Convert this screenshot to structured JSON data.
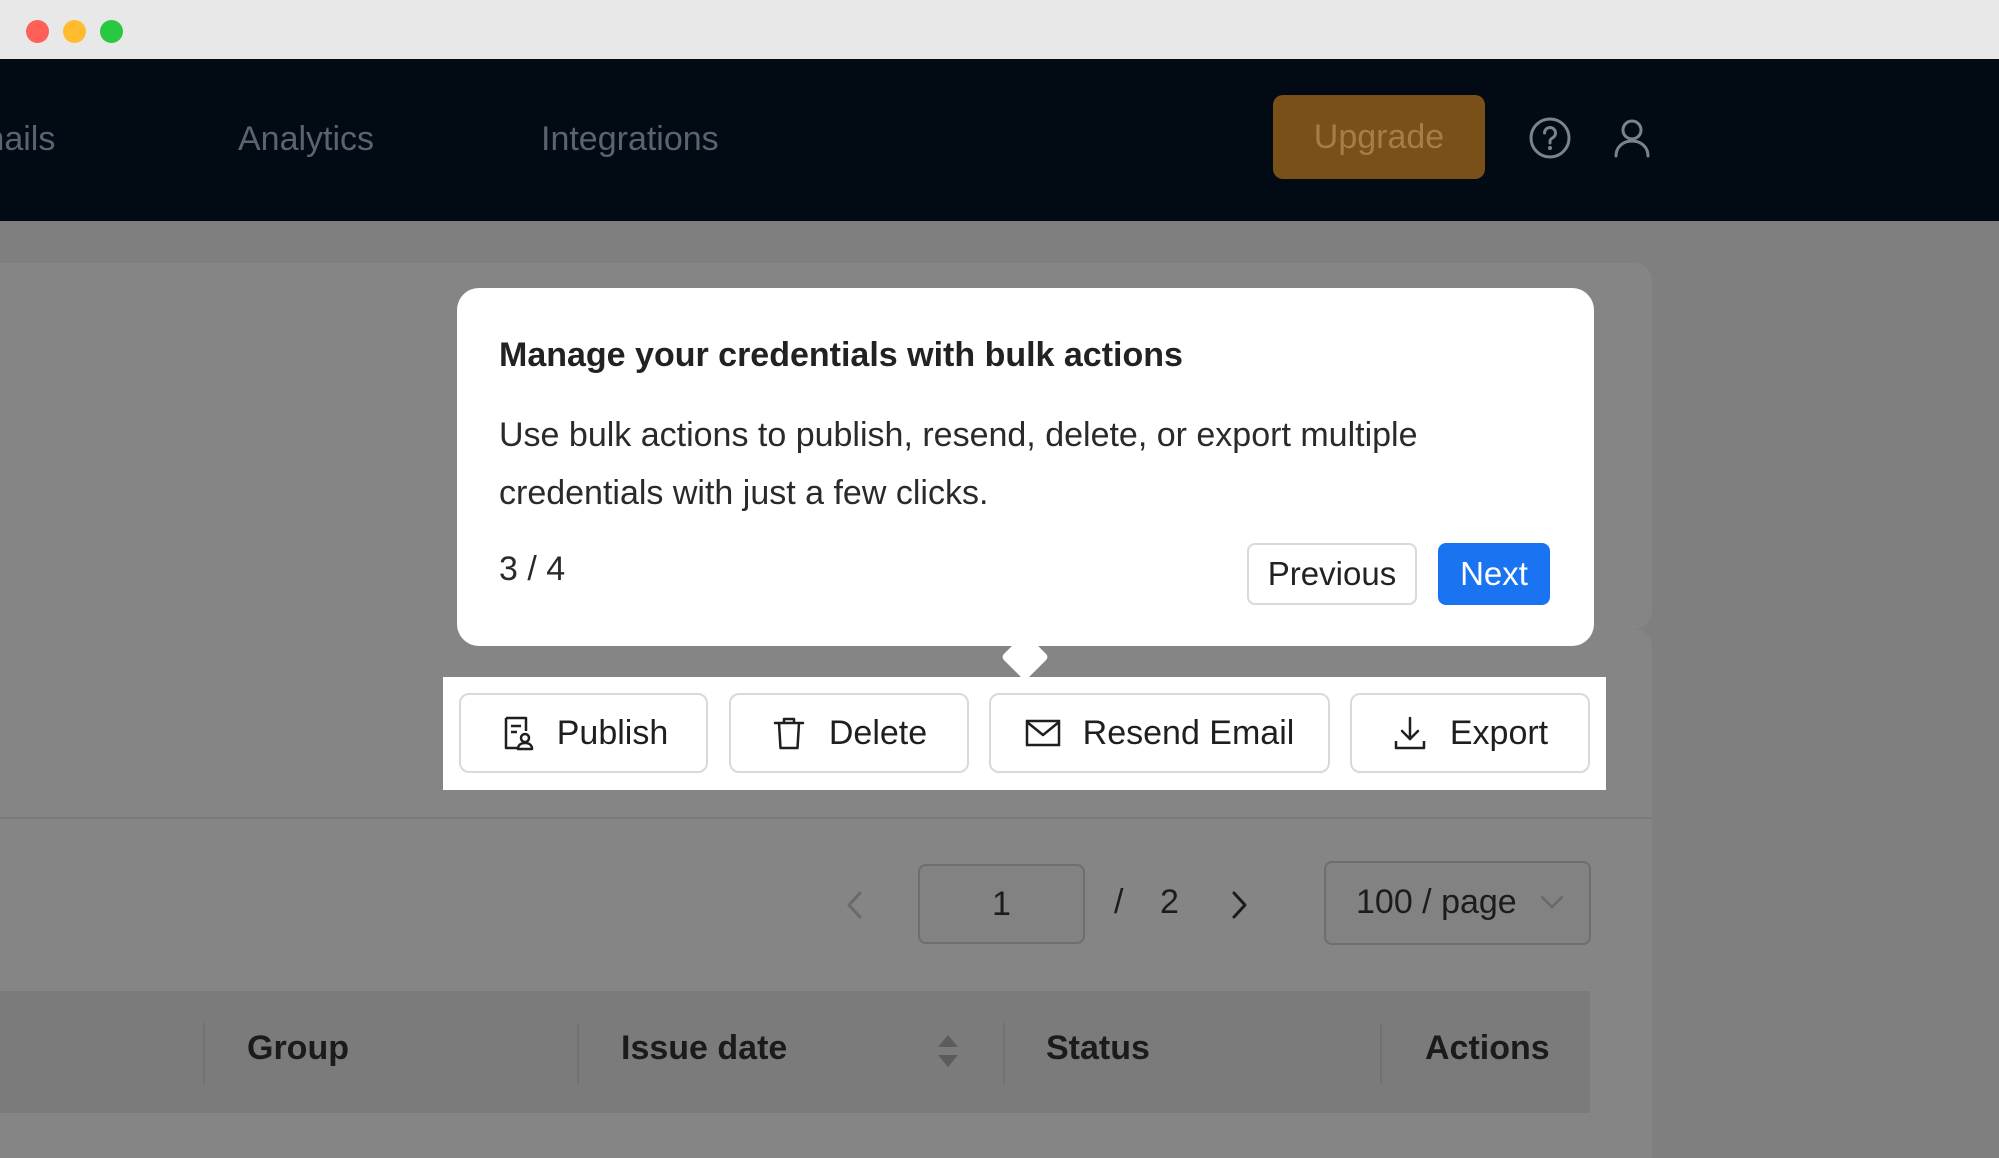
{
  "window": {
    "controls": [
      "close",
      "minimize",
      "maximize"
    ]
  },
  "nav": {
    "items": [
      "mails",
      "Analytics",
      "Integrations"
    ],
    "upgrade_label": "Upgrade",
    "icons": [
      "help-circle-icon",
      "user-icon"
    ]
  },
  "tour": {
    "title": "Manage your credentials with bulk actions",
    "description": "Use bulk actions to publish, resend, delete, or export multiple credentials with just a few clicks.",
    "step": "3 / 4",
    "previous_label": "Previous",
    "next_label": "Next"
  },
  "bulk_actions": {
    "publish": "Publish",
    "delete": "Delete",
    "resend": "Resend Email",
    "export": "Export"
  },
  "pagination": {
    "current_page": "1",
    "separator": "/",
    "total_pages": "2",
    "page_size": "100 / page"
  },
  "table": {
    "columns": [
      "Group",
      "Issue date",
      "Status",
      "Actions"
    ]
  },
  "colors": {
    "primary": "#1a73f0",
    "upgrade": "#7a5019",
    "navbar": "#020b14",
    "overlay": "#7f7f7f"
  }
}
